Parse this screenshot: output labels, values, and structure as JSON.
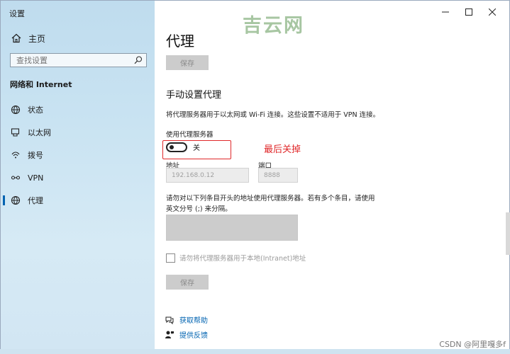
{
  "window": {
    "title": "设置"
  },
  "watermark": "吉云网",
  "sidebar": {
    "home_label": "主页",
    "search_placeholder": "查找设置",
    "section_title": "网络和 Internet",
    "items": [
      {
        "label": "状态",
        "icon": "status-icon"
      },
      {
        "label": "以太网",
        "icon": "ethernet-icon"
      },
      {
        "label": "拨号",
        "icon": "dialup-icon"
      },
      {
        "label": "VPN",
        "icon": "vpn-icon"
      },
      {
        "label": "代理",
        "icon": "proxy-icon",
        "active": true
      }
    ]
  },
  "main": {
    "title": "代理",
    "save_top": "保存",
    "manual_title": "手动设置代理",
    "manual_desc": "将代理服务器用于以太网或 Wi-Fi 连接。这些设置不适用于 VPN 连接。",
    "use_proxy_label": "使用代理服务器",
    "toggle_state": "关",
    "annotation": "最后关掉",
    "address_label": "地址",
    "address_value": "192.168.0.12",
    "port_label": "端口",
    "port_value": "8888",
    "exceptions_desc": "请勿对以下列条目开头的地址使用代理服务器。若有多个条目，请使用英文分号 (;) 来分隔。",
    "local_checkbox": "请勿将代理服务器用于本地(Intranet)地址",
    "save_bottom": "保存",
    "help_link": "获取帮助",
    "feedback_link": "提供反馈"
  },
  "credit": "CSDN @阿里嘎多f"
}
